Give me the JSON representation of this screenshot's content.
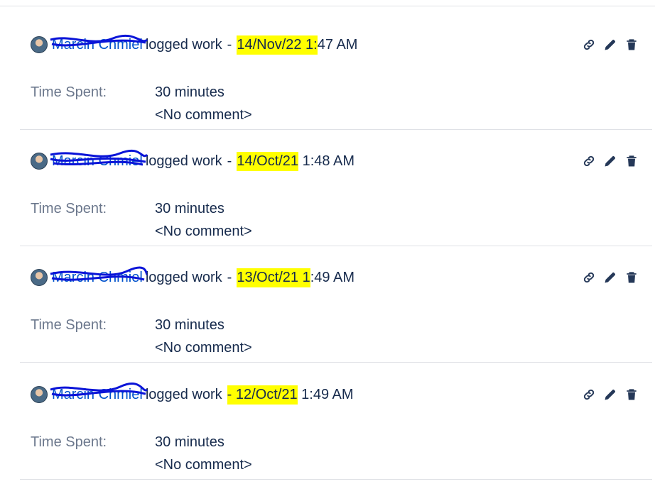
{
  "worklogs": [
    {
      "author": "Marcin Chmiel",
      "action_text": "logged work",
      "separator": "-",
      "date_highlight": "14/Nov/22 1:",
      "date_rest": "47 AM",
      "time_spent_label": "Time Spent:",
      "time_spent": "30 minutes",
      "comment": "<No comment>"
    },
    {
      "author": "Marcin Chmiel",
      "action_text": "logged work",
      "separator": "-",
      "date_highlight": "14/Oct/21",
      "date_rest": "1:48 AM",
      "time_spent_label": "Time Spent:",
      "time_spent": "30 minutes",
      "comment": "<No comment>"
    },
    {
      "author": "Marcin Chmiel",
      "action_text": "logged work",
      "separator": "-",
      "date_highlight": "13/Oct/21 1",
      "date_rest": ":49 AM",
      "time_spent_label": "Time Spent:",
      "time_spent": "30 minutes",
      "comment": "<No comment>"
    },
    {
      "author": "Marcin Chmiel",
      "action_text": "logged work",
      "separator": "-",
      "date_highlight": "12/Oct/21",
      "date_rest": "1:49 AM",
      "time_spent_label": "Time Spent:",
      "time_spent": "30 minutes",
      "comment": "<No comment>"
    }
  ],
  "icons": {
    "link": "link-icon",
    "edit": "pencil-icon",
    "delete": "trash-icon"
  },
  "colors": {
    "highlight": "#ffff00",
    "link": "#0052cc",
    "scribble": "#0a14d8",
    "text": "#172b4d",
    "muted": "#6b778c"
  }
}
